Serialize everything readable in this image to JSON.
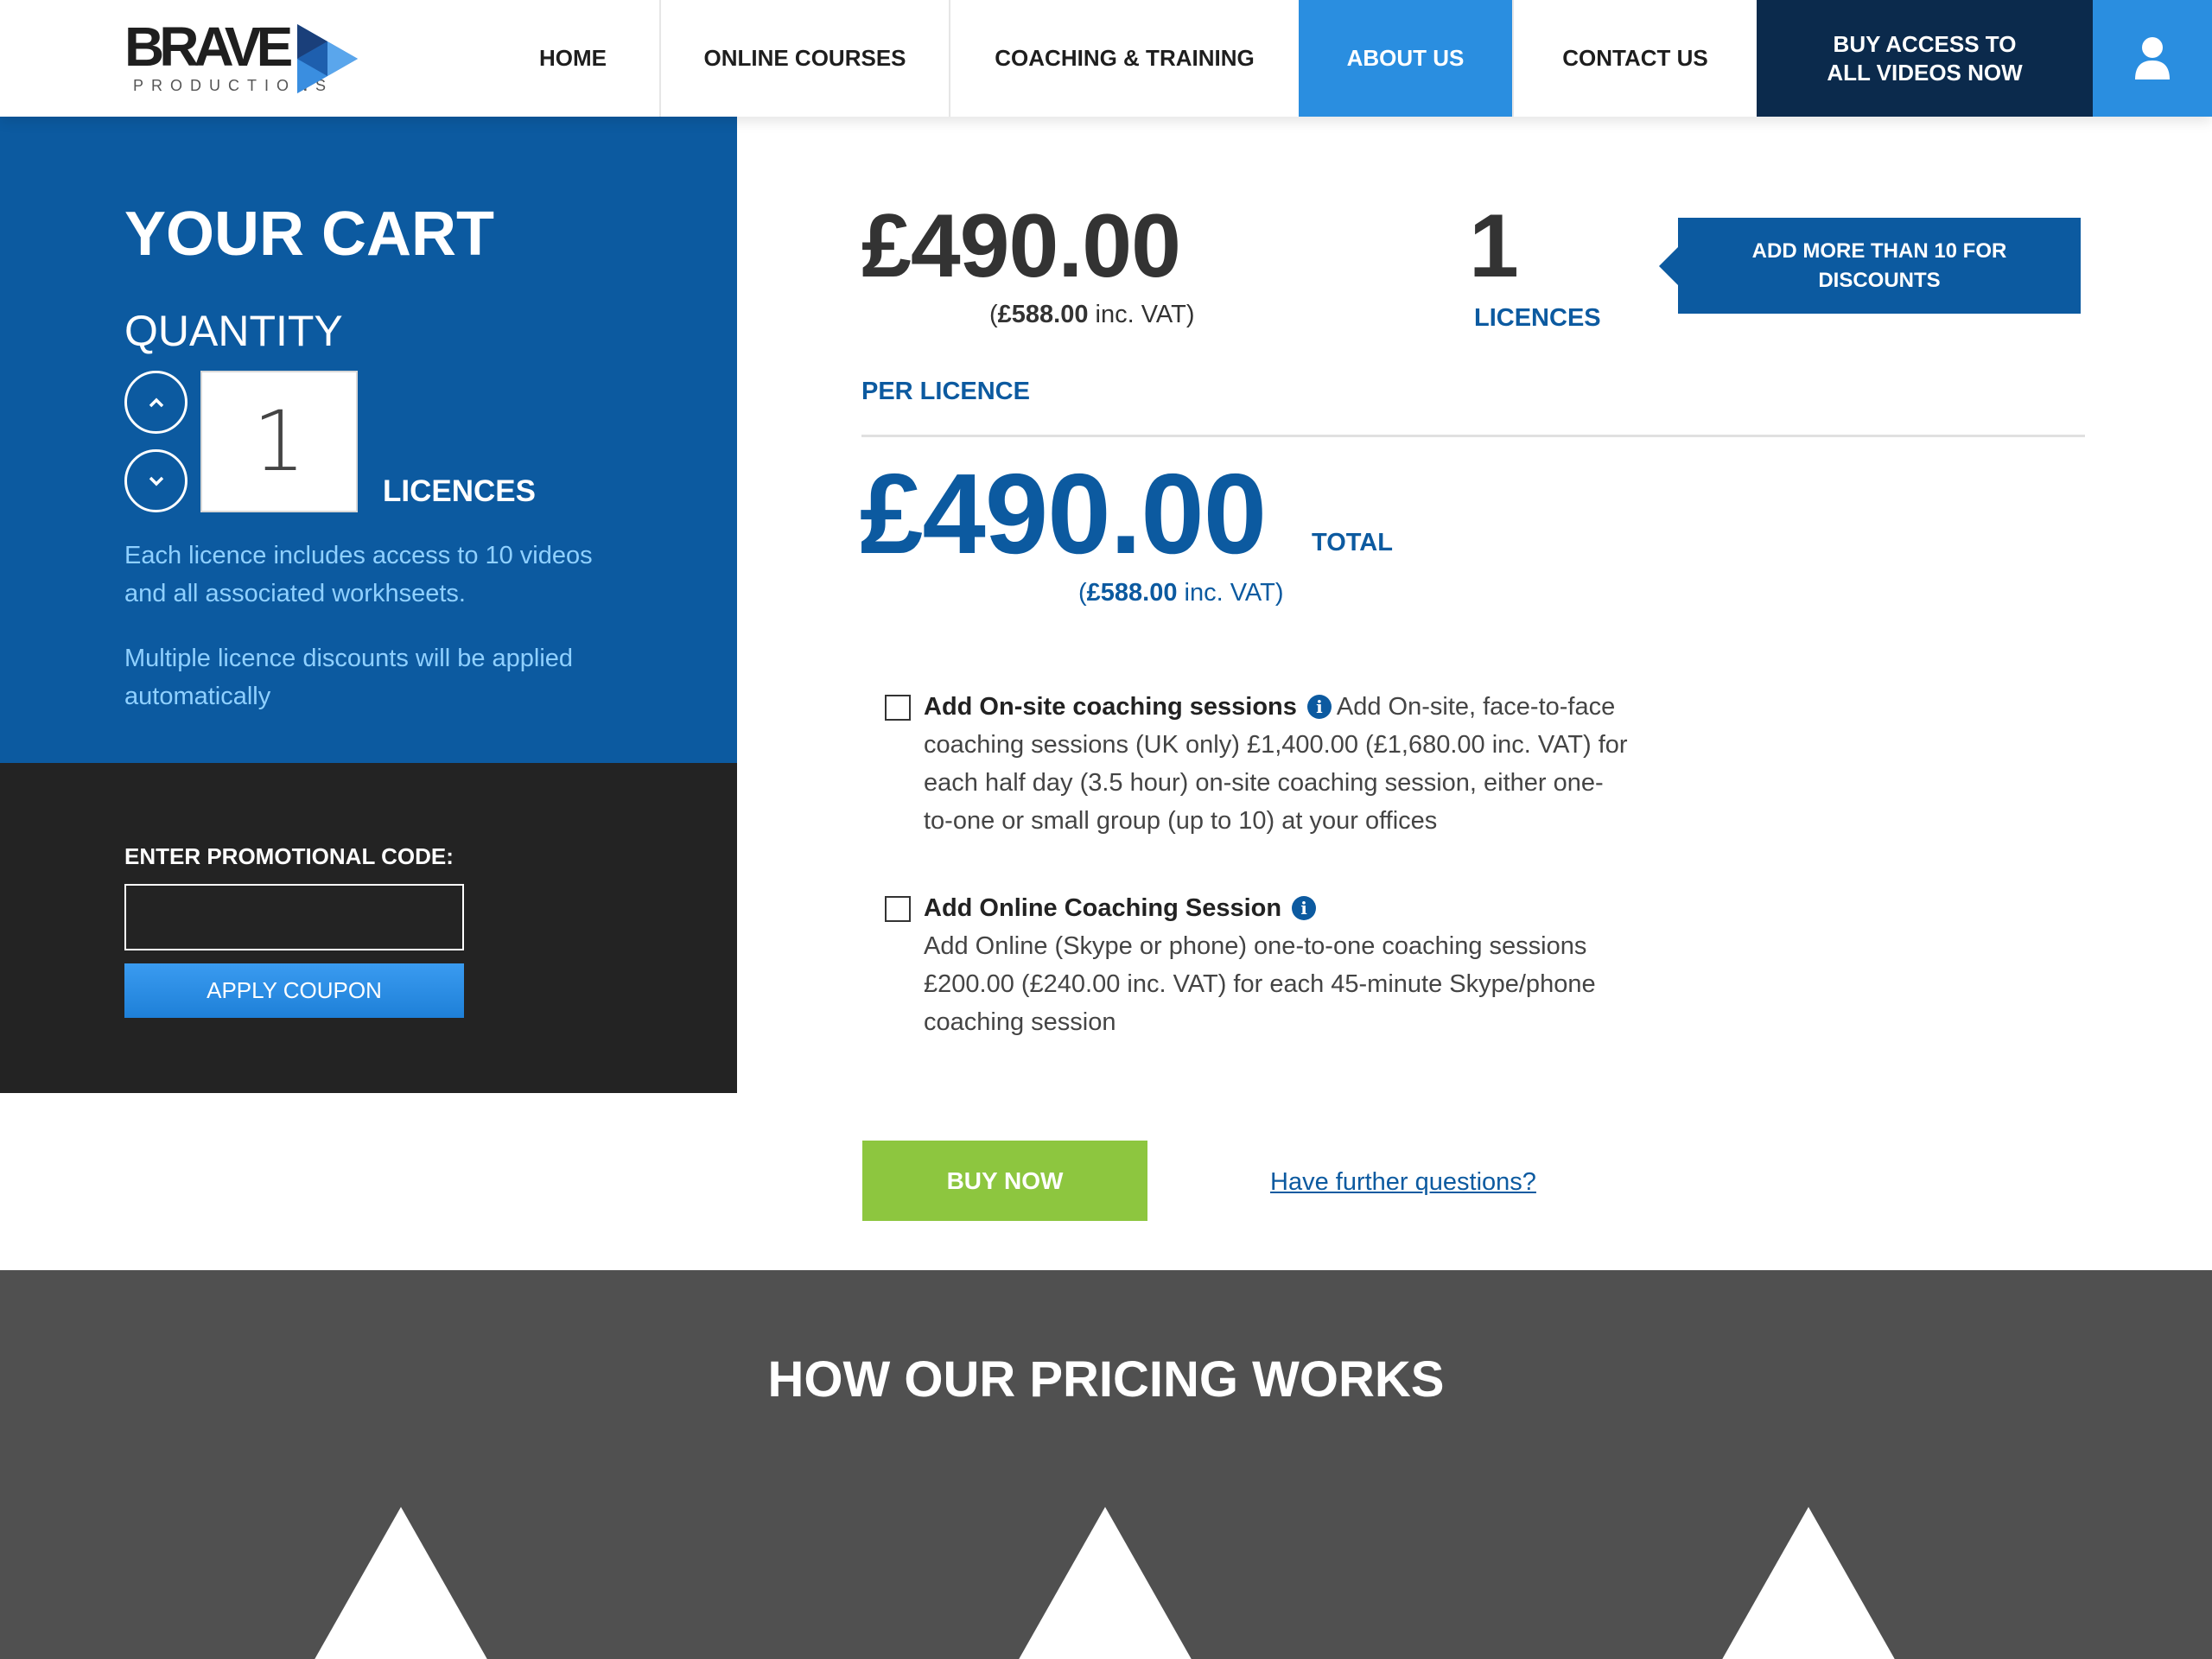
{
  "header": {
    "logo_text": "BRAVE",
    "logo_sub": "PRODUCTIONS",
    "nav": [
      "HOME",
      "ONLINE COURSES",
      "COACHING & TRAINING",
      "ABOUT US",
      "CONTACT US"
    ],
    "active_nav": "ABOUT US",
    "buy_access_label": "BUY ACCESS TO ALL VIDEOS NOW",
    "user_icon": "user-icon"
  },
  "cart": {
    "title": "YOUR CART",
    "quantity_label": "QUANTITY",
    "quantity_value": "1",
    "unit_label": "LICENCES",
    "note1": "Each licence includes access to 10 videos and all associated workhseets.",
    "note2": "Multiple licence discounts will be applied automatically"
  },
  "promo": {
    "label": "ENTER PROMOTIONAL CODE:",
    "input_value": "",
    "button_label": "APPLY COUPON"
  },
  "pricing": {
    "per_licence_price": "£490.00",
    "per_licence_vat_amount": "£588.00",
    "vat_suffix": " inc. VAT",
    "licences_count": "1",
    "licences_label": "LICENCES",
    "discount_badge": "ADD MORE THAN 10 FOR DISCOUNTS",
    "per_licence_label": "PER LICENCE",
    "total_price": "£490.00",
    "total_label": "TOTAL",
    "total_vat_amount": "£588.00"
  },
  "addons": [
    {
      "title": "Add On-site coaching sessions",
      "description": "Add On-site, face-to-face coaching sessions (UK only) £1,400.00 (£1,680.00 inc. VAT) for each half day (3.5 hour) on-site coaching session, either one-to-one or small group (up to 10) at your offices",
      "checked": false
    },
    {
      "title": "Add Online Coaching Session",
      "description": "Add Online (Skype or phone) one-to-one coaching sessions £200.00 (£240.00 inc. VAT) for each 45-minute Skype/phone coaching session",
      "checked": false
    }
  ],
  "actions": {
    "buy_now_label": "BUY NOW",
    "questions_link": "Have further questions?"
  },
  "pricing_section": {
    "title": "HOW OUR PRICING WORKS"
  },
  "colors": {
    "brand_blue": "#0c5aa0",
    "accent_blue": "#2a8ee0",
    "navy": "#0b2a4c",
    "buy_green": "#8dc63f",
    "dark_panel": "#232323",
    "section_gray": "#505050"
  }
}
